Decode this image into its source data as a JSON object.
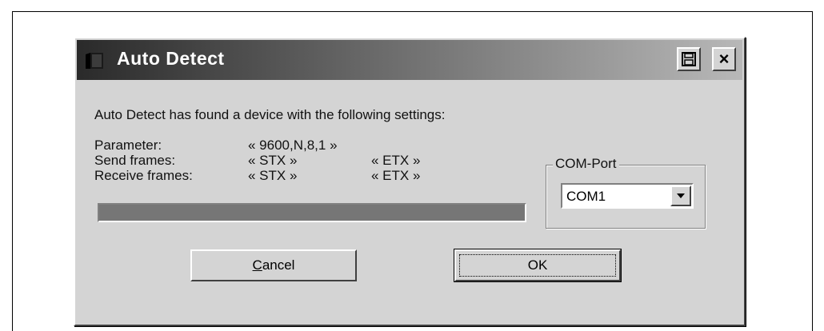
{
  "dialog": {
    "title": "Auto Detect",
    "message": "Auto Detect has found a device with the following settings:",
    "settings": {
      "parameter_label": "Parameter:",
      "parameter_value": "« 9600,N,8,1 »",
      "send_label": "Send frames:",
      "send_start": "« STX »",
      "send_end": "« ETX »",
      "receive_label": "Receive frames:",
      "receive_start": "« STX »",
      "receive_end": "« ETX »"
    },
    "progress": 1.0,
    "com_port": {
      "label": "COM-Port",
      "selected": "COM1"
    },
    "buttons": {
      "cancel": "Cancel",
      "ok": "OK"
    },
    "titlebar_buttons": {
      "close": "×"
    }
  }
}
